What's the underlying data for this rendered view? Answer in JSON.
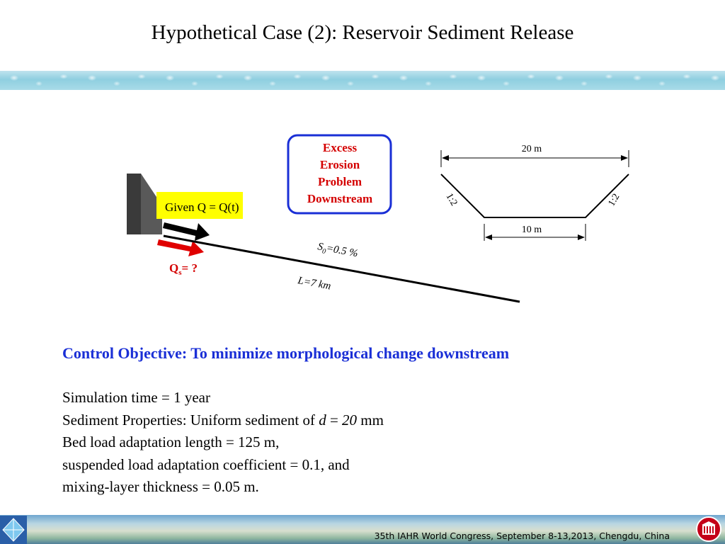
{
  "title": "Hypothetical Case (2): Reservoir Sediment Release",
  "diagram": {
    "given_q": "Given Q = Q(t)",
    "qs_main": "Q",
    "qs_sub": "s",
    "qs_rest": "= ?",
    "slope_s": "S",
    "slope_sub": "0",
    "slope_rest": "=0.5 %",
    "length_label": "L=7 km",
    "excess_box": [
      "Excess",
      "Erosion",
      "Problem",
      "Downstream"
    ],
    "top_width": "20 m",
    "bottom_width": "10 m",
    "side_slope_left": "1:2",
    "side_slope_right": "1:2"
  },
  "objective": "Control Objective: To minimize morphological change downstream",
  "params": {
    "line1": "Simulation time = 1 year",
    "line2_a": "Sediment  Properties: Uniform sediment of ",
    "line2_d": "d",
    "line2_eq": " = ",
    "line2_val": "20",
    "line2_unit": " mm",
    "line3": "Bed load adaptation length = 125 m,",
    "line4": "suspended load adaptation coefficient = 0.1, and",
    "line5": "mixing-layer thickness = 0.05 m."
  },
  "footer": "35th IAHR World Congress, September 8-13,2013, Chengdu, China",
  "colors": {
    "blue_text": "#1a2fd6",
    "red_text": "#d40000",
    "yellow": "#ffff00",
    "red_arrow": "#e00000"
  }
}
